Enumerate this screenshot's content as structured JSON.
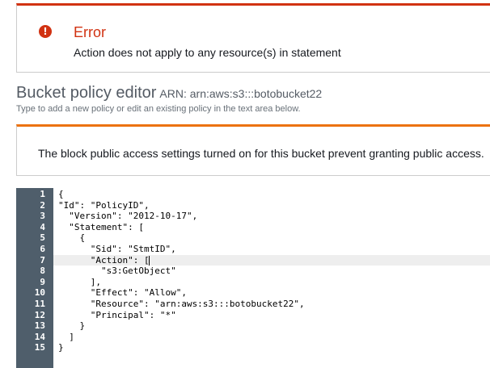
{
  "error": {
    "icon": "exclamation-circle-icon",
    "icon_glyph": "!",
    "title": "Error",
    "message": "Action does not apply to any resource(s) in statement",
    "color": "#d13212"
  },
  "editor": {
    "title": "Bucket policy editor",
    "arn": "ARN: arn:aws:s3:::botobucket22",
    "subtitle": "Type to add a new policy or edit an existing policy in the text area below."
  },
  "warning": {
    "message": "The block public access settings turned on for this bucket prevent granting public access.",
    "color": "#ec7211"
  },
  "code": {
    "active_line": 7,
    "lines": [
      {
        "n": "1",
        "text": "{"
      },
      {
        "n": "2",
        "text": "\"Id\": \"PolicyID\","
      },
      {
        "n": "3",
        "text": "  \"Version\": \"2012-10-17\","
      },
      {
        "n": "4",
        "text": "  \"Statement\": ["
      },
      {
        "n": "5",
        "text": "    {"
      },
      {
        "n": "6",
        "text": "      \"Sid\": \"StmtID\","
      },
      {
        "n": "7",
        "text": "      \"Action\": ["
      },
      {
        "n": "8",
        "text": "        \"s3:GetObject\""
      },
      {
        "n": "9",
        "text": "      ],"
      },
      {
        "n": "10",
        "text": "      \"Effect\": \"Allow\","
      },
      {
        "n": "11",
        "text": "      \"Resource\": \"arn:aws:s3:::botobucket22\","
      },
      {
        "n": "12",
        "text": "      \"Principal\": \"*\""
      },
      {
        "n": "13",
        "text": "    }"
      },
      {
        "n": "14",
        "text": "  ]"
      },
      {
        "n": "15",
        "text": "}"
      }
    ]
  }
}
